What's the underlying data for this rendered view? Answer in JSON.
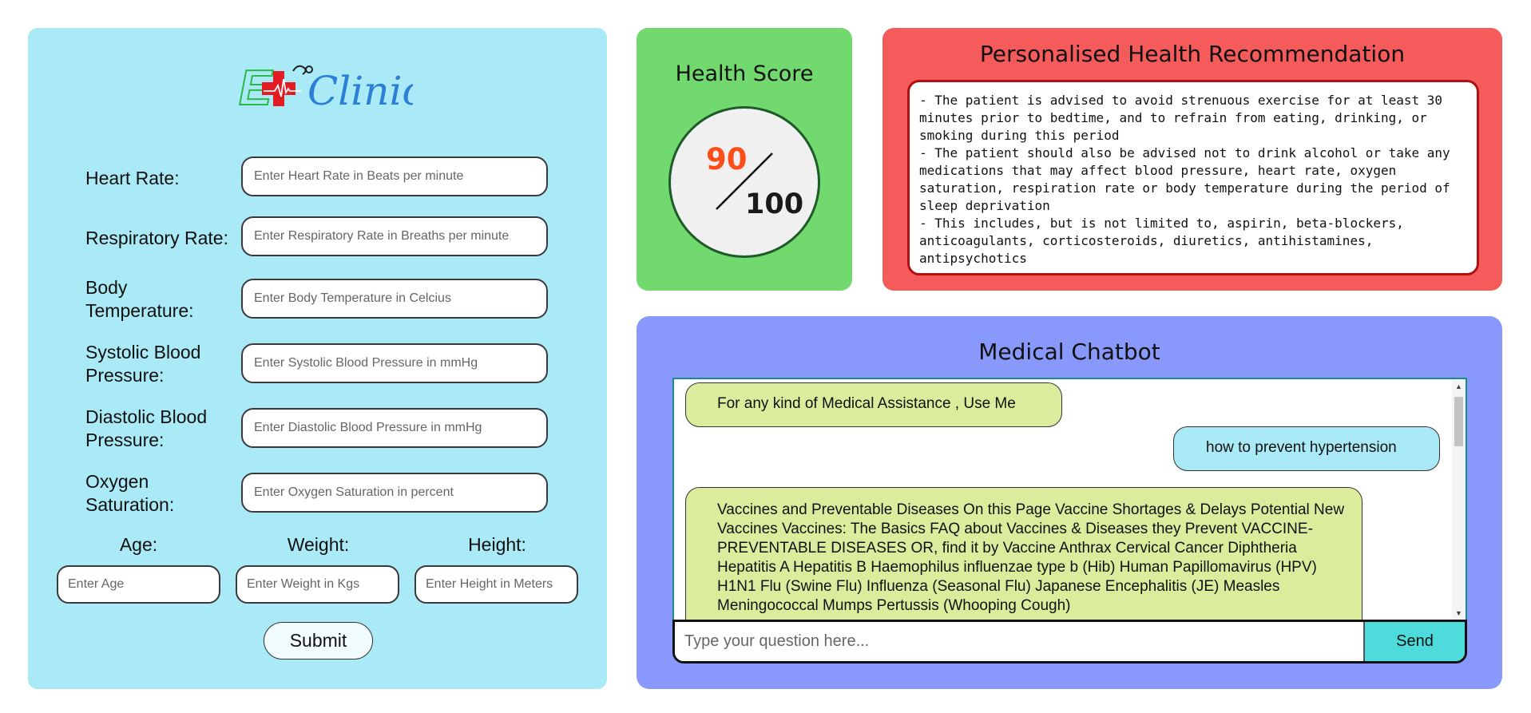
{
  "logo": {
    "text_e": "E",
    "text_clinic": "Clinic"
  },
  "form": {
    "fields": [
      {
        "label": "Heart Rate:",
        "placeholder": "Enter Heart Rate in Beats per minute"
      },
      {
        "label": "Respiratory Rate:",
        "placeholder": "Enter Respiratory Rate in Breaths per minute"
      },
      {
        "label": "Body Temperature:",
        "placeholder": "Enter Body Temperature in Celcius"
      },
      {
        "label": "Systolic Blood Pressure:",
        "placeholder": "Enter Systolic Blood Pressure in mmHg"
      },
      {
        "label": "Diastolic Blood Pressure:",
        "placeholder": "Enter Diastolic Blood Pressure in mmHg"
      },
      {
        "label": "Oxygen Saturation:",
        "placeholder": "Enter Oxygen Saturation in percent"
      }
    ],
    "age": {
      "label": "Age:",
      "placeholder": "Enter Age"
    },
    "weight": {
      "label": "Weight:",
      "placeholder": "Enter Weight in Kgs"
    },
    "height": {
      "label": "Height:",
      "placeholder": "Enter Height in Meters"
    },
    "submit_label": "Submit",
    "colors": {
      "panel": "#aae9f6"
    }
  },
  "health_score": {
    "title": "Health Score",
    "value": "90",
    "max": "100",
    "colors": {
      "panel": "#72d96f",
      "value": "#ff4d1a"
    }
  },
  "recommendation": {
    "title": "Personalised Health Recommendation",
    "text": "- The patient is advised to avoid strenuous exercise for at least 30 minutes prior to bedtime, and to refrain from eating, drinking, or smoking during this period\n- The patient should also be advised not to drink alcohol or take any medications that may affect blood pressure, heart rate, oxygen saturation, respiration rate or body temperature during the period of sleep deprivation\n- This includes, but is not limited to, aspirin, beta-blockers, anticoagulants, corticosteroids, diuretics, antihistamines, antipsychotics",
    "colors": {
      "panel": "#f55b5b",
      "border": "#b01010"
    }
  },
  "chatbot": {
    "title": "Medical Chatbot",
    "messages": [
      {
        "role": "bot",
        "text": "For any kind of Medical Assistance , Use Me"
      },
      {
        "role": "user",
        "text": "how to prevent hypertension"
      },
      {
        "role": "bot",
        "text": "Vaccines and Preventable Diseases On this Page Vaccine Shortages & Delays Potential New Vaccines Vaccines: The Basics FAQ about Vaccines & Diseases they Prevent VACCINE-PREVENTABLE DISEASES OR, find it by Vaccine Anthrax Cervical Cancer Diphtheria Hepatitis A Hepatitis B Haemophilus influenzae type b (Hib) Human Papillomavirus (HPV) H1N1 Flu (Swine Flu) Influenza (Seasonal Flu) Japanese Encephalitis (JE) Measles Meningococcal Mumps Pertussis (Whooping Cough)"
      }
    ],
    "input_placeholder": "Type your question here...",
    "send_label": "Send",
    "colors": {
      "panel": "#8899fb",
      "bot_bubble": "#dbed9c",
      "user_bubble": "#aae9f6",
      "send": "#4ddbdb"
    }
  }
}
